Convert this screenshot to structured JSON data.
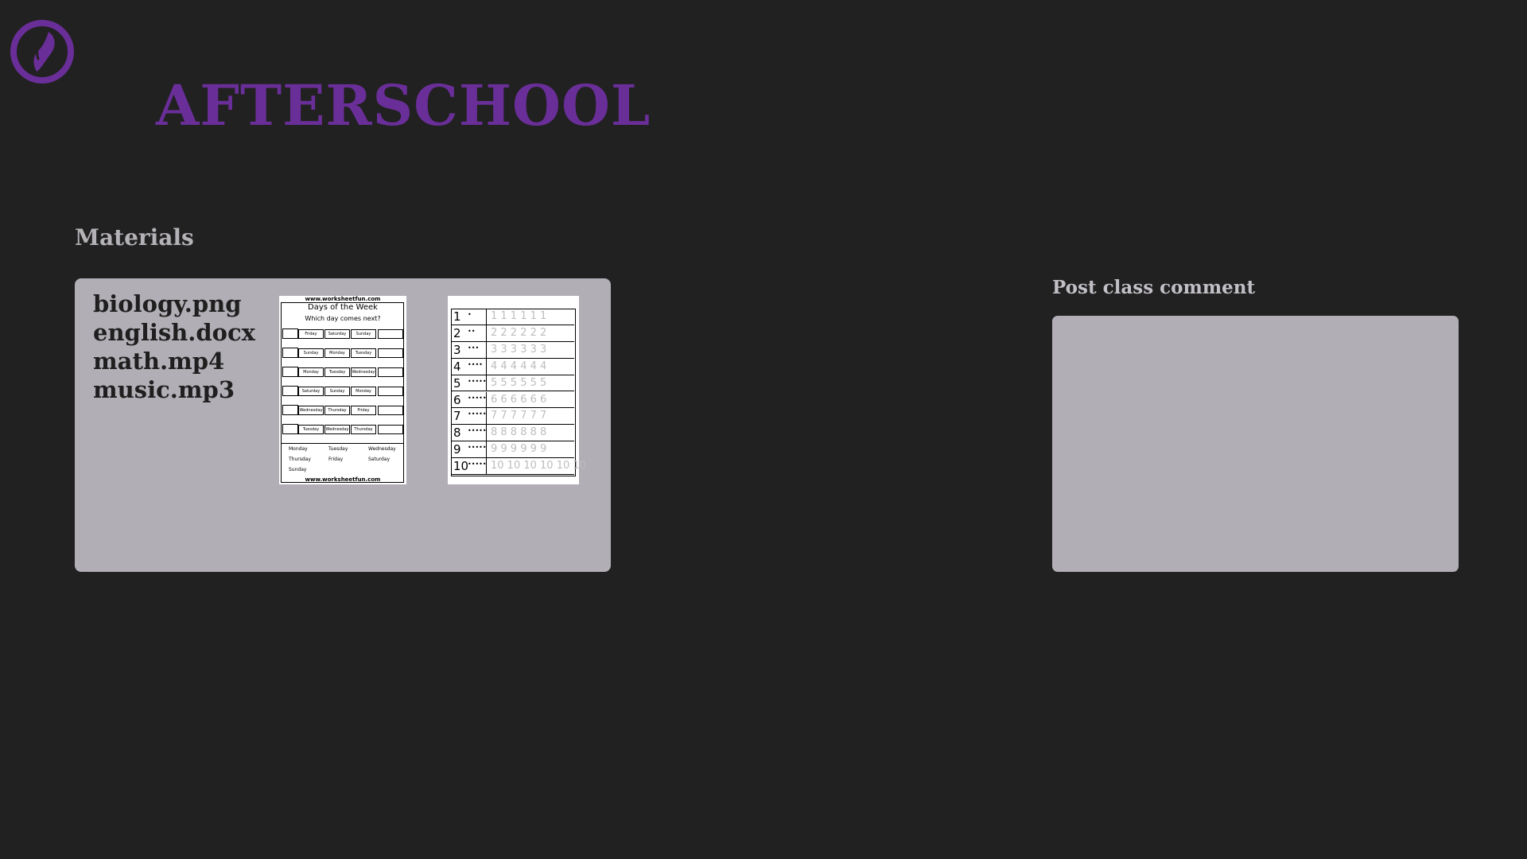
{
  "brand": {
    "name": "AFTERSCHOOL",
    "logo_icon": "leaf-circle-icon",
    "color": "#6a2e99"
  },
  "materials": {
    "title": "Materials",
    "files": [
      {
        "name": "biology.png"
      },
      {
        "name": "english.docx"
      },
      {
        "name": "math.mp4"
      },
      {
        "name": "music.mp3"
      }
    ],
    "thumbnails": [
      {
        "site": "www.worksheetfun.com",
        "title": "Days of the Week",
        "subtitle": "Which day comes next?",
        "rows": [
          [
            "Friday",
            "Saturday",
            "Sunday"
          ],
          [
            "Sunday",
            "Monday",
            "Tuesday"
          ],
          [
            "Monday",
            "Tuesday",
            "Wednesday"
          ],
          [
            "Saturday",
            "Sunday",
            "Monday"
          ],
          [
            "Wednesday",
            "Thursday",
            "Friday"
          ],
          [
            "Tuesday",
            "Wednesday",
            "Thursday"
          ]
        ],
        "word_bank": [
          "Monday",
          "Tuesday",
          "Wednesday",
          "Thursday",
          "Friday",
          "Saturday",
          "Sunday"
        ],
        "footer": "www.worksheetfun.com"
      },
      {
        "numbers": [
          "1",
          "2",
          "3",
          "4",
          "5",
          "6",
          "7",
          "8",
          "9",
          "10"
        ]
      }
    ]
  },
  "comment": {
    "title": "Post class comment",
    "placeholder": ""
  },
  "colors": {
    "background": "#212121",
    "panel": "#b1aeb5",
    "heading": "#b4b1b7"
  }
}
